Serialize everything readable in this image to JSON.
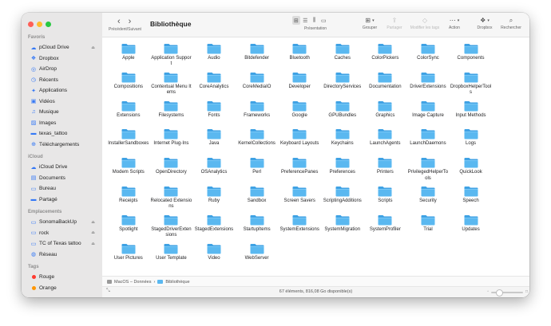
{
  "window": {
    "title": "Bibliothèque"
  },
  "sidebar": {
    "sections": [
      {
        "title": "Favoris",
        "items": [
          {
            "label": "pCloud Drive",
            "icon": "cloud-icon",
            "eject": true
          },
          {
            "label": "Dropbox",
            "icon": "dropbox-icon"
          },
          {
            "label": "AirDrop",
            "icon": "airdrop-icon"
          },
          {
            "label": "Récents",
            "icon": "clock-icon"
          },
          {
            "label": "Applications",
            "icon": "applications-icon"
          },
          {
            "label": "Vidéos",
            "icon": "film-icon"
          },
          {
            "label": "Musique",
            "icon": "music-icon"
          },
          {
            "label": "Images",
            "icon": "photo-icon"
          },
          {
            "label": "texas_tattoo",
            "icon": "folder-icon"
          },
          {
            "label": "Téléchargements",
            "icon": "download-icon"
          }
        ]
      },
      {
        "title": "iCloud",
        "items": [
          {
            "label": "iCloud Drive",
            "icon": "icloud-icon"
          },
          {
            "label": "Documents",
            "icon": "document-icon"
          },
          {
            "label": "Bureau",
            "icon": "desktop-icon"
          },
          {
            "label": "Partagé",
            "icon": "shared-folder-icon"
          }
        ]
      },
      {
        "title": "Emplacements",
        "items": [
          {
            "label": "SonomaBackUp",
            "icon": "disk-icon",
            "eject": true
          },
          {
            "label": "rock",
            "icon": "disk-icon",
            "eject": true
          },
          {
            "label": "TC of Texas tattoo",
            "icon": "disk-icon",
            "eject": true
          },
          {
            "label": "Réseau",
            "icon": "network-icon"
          }
        ]
      },
      {
        "title": "Tags",
        "items": [
          {
            "label": "Rouge",
            "tag_color": "#ff3b30"
          },
          {
            "label": "Orange",
            "tag_color": "#ff9500"
          }
        ]
      }
    ]
  },
  "toolbar": {
    "nav_caption": "Précédent/Suivant",
    "presentation_label": "Présentation",
    "grouper_label": "Grouper",
    "partager_label": "Partager",
    "modifier_tags_label": "Modifier les tags",
    "action_label": "Action",
    "dropbox_label": "Dropbox",
    "rechercher_label": "Rechercher"
  },
  "folders": [
    "Apple",
    "Application Support",
    "Audio",
    "Bitdefender",
    "Bluetooth",
    "Caches",
    "ColorPickers",
    "ColorSync",
    "Components",
    "Compositions",
    "Contextual Menu Items",
    "CoreAnalytics",
    "CoreMediaIO",
    "Developer",
    "DirectoryServices",
    "Documentation",
    "DriverExtensions",
    "DropboxHelperTools",
    "Extensions",
    "Filesystems",
    "Fonts",
    "Frameworks",
    "Google",
    "GPUBundles",
    "Graphics",
    "Image Capture",
    "Input Methods",
    "InstallerSandboxes",
    "Internet Plug-Ins",
    "Java",
    "KernelCollections",
    "Keyboard Layouts",
    "Keychains",
    "LaunchAgents",
    "LaunchDaemons",
    "Logs",
    "Modem Scripts",
    "OpenDirectory",
    "OSAnalytics",
    "Perl",
    "PreferencePanes",
    "Preferences",
    "Printers",
    "PrivilegedHelperTools",
    "QuickLook",
    "Receipts",
    "Relocated Extensions",
    "Ruby",
    "Sandbox",
    "Screen Savers",
    "ScriptingAdditions",
    "Scripts",
    "Security",
    "Speech",
    "Spotlight",
    "StagedDriverExtensions",
    "StagedExtensions",
    "StartupItems",
    "SystemExtensions",
    "SystemMigration",
    "SystemProfiler",
    "Trial",
    "Updates",
    "User Pictures",
    "User Template",
    "Video",
    "WebServer"
  ],
  "pathbar": {
    "volume": "MacOS – Données",
    "separator": "›",
    "folder": "Bibliothèque"
  },
  "status": {
    "text": "67 éléments, 816,08 Go disponible(s)"
  },
  "colors": {
    "folder_front": "#5ab8f0",
    "folder_back": "#3fa2e4",
    "accent": "#3478f6"
  }
}
